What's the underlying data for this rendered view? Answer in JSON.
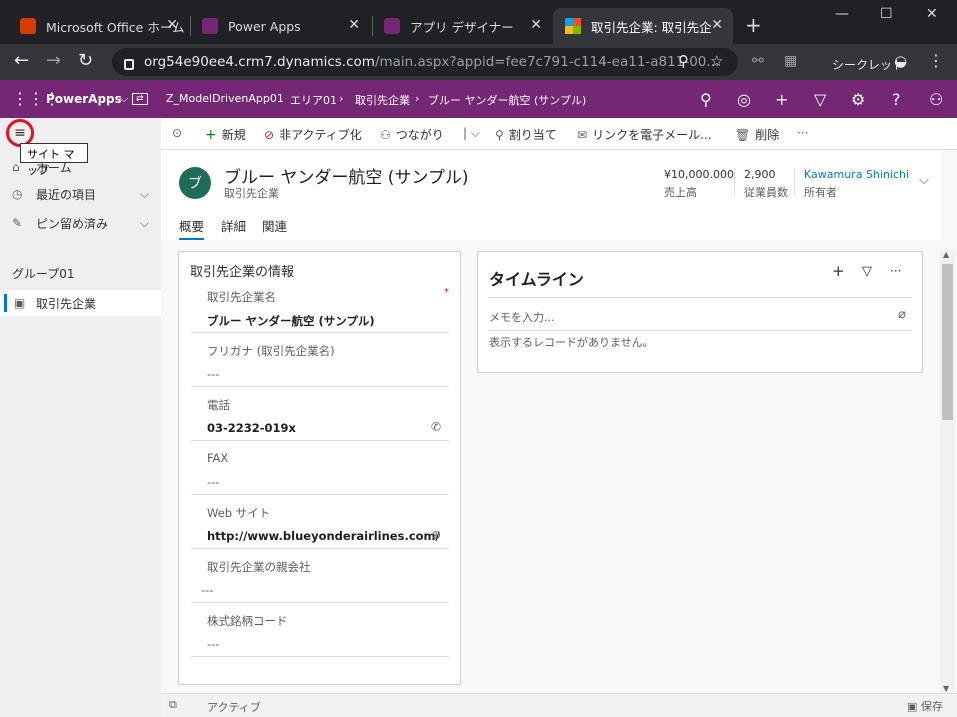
{
  "browser": {
    "tabs": [
      {
        "label": "Microsoft Office ホーム"
      },
      {
        "label": "Power Apps"
      },
      {
        "label": "アプリ デザイナー"
      },
      {
        "label": "取引先企業: 取引先企"
      }
    ],
    "url_main": "org54e90ee4.crm7.dynamics.com",
    "url_rest": "/main.aspx?appid=fee7c791-c114-ea11-a811-00...",
    "incognito_label": "シークレット"
  },
  "app": {
    "brand": "PowerApps",
    "app_name": "Z_ModelDrivenApp01",
    "breadcrumb": [
      "エリア01",
      "取引先企業",
      "ブルー ヤンダー航空 (サンプル)"
    ]
  },
  "sitemap": {
    "tooltip": "サイト マップ",
    "home": "ホーム",
    "recent": "最近の項目",
    "pinned": "ピン留め済み",
    "group": "グループ01",
    "entity": "取引先企業"
  },
  "commands": {
    "new": "新規",
    "deactivate": "非アクティブ化",
    "connect": "つながり",
    "assign": "割り当て",
    "email_link": "リンクを電子メール...",
    "delete": "削除"
  },
  "record": {
    "avatar": "ブ",
    "title": "ブルー ヤンダー航空 (サンプル)",
    "type": "取引先企業",
    "revenue_value": "¥10,000.000",
    "revenue_label": "売上高",
    "employees_value": "2,900",
    "employees_label": "従業員数",
    "owner_value": "Kawamura Shinichi",
    "owner_label": "所有者"
  },
  "tabs": [
    "概要",
    "詳細",
    "関連"
  ],
  "info_card": {
    "title": "取引先企業の情報",
    "fields": [
      {
        "label": "取引先企業名",
        "value": "ブルー ヤンダー航空 (サンプル)"
      },
      {
        "label": "フリガナ (取引先企業名)",
        "value": "---"
      },
      {
        "label": "電話",
        "value": "03-2232-019x"
      },
      {
        "label": "FAX",
        "value": "---"
      },
      {
        "label": "Web サイト",
        "value": "http://www.blueyonderairlines.com/"
      },
      {
        "label": "取引先企業の親会社",
        "value": "---"
      },
      {
        "label": "株式銘柄コード",
        "value": "---"
      }
    ]
  },
  "timeline": {
    "title": "タイムライン",
    "memo_placeholder": "メモを入力...",
    "no_records": "表示するレコードがありません。"
  },
  "status": {
    "state": "アクティブ",
    "save": "保存"
  }
}
